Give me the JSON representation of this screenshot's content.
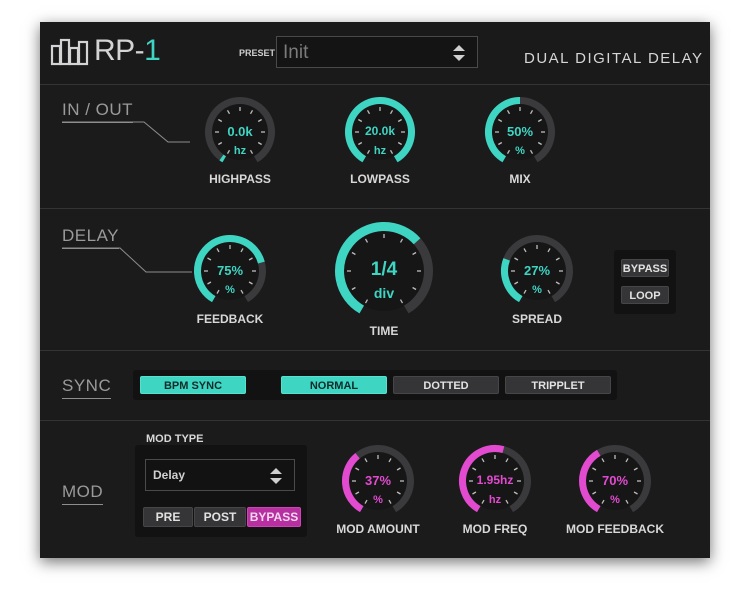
{
  "header": {
    "brand": "RP-",
    "brand_accent": "1",
    "preset_label": "PRESET",
    "preset_value": "Init",
    "title": "DUAL DIGITAL DELAY"
  },
  "sections": {
    "inout": "IN / OUT",
    "delay": "DELAY",
    "sync": "SYNC",
    "mod": "MOD"
  },
  "colors": {
    "accent": "#3fd5c3",
    "mod_accent": "#e24ad0",
    "track": "#3a3a3c",
    "background": "#1b1b1c"
  },
  "knobs": {
    "highpass": {
      "label": "HIGHPASS",
      "value": "0.0k",
      "unit": "hz",
      "level": 0.02
    },
    "lowpass": {
      "label": "LOWPASS",
      "value": "20.0k",
      "unit": "hz",
      "level": 1.0
    },
    "mix": {
      "label": "MIX",
      "value": "50%",
      "unit": "%",
      "level": 0.5
    },
    "feedback": {
      "label": "FEEDBACK",
      "value": "75%",
      "unit": "%",
      "level": 0.75
    },
    "time": {
      "label": "TIME",
      "value": "1/4",
      "unit": "div",
      "level": 0.66
    },
    "spread": {
      "label": "SPREAD",
      "value": "27%",
      "unit": "%",
      "level": 0.27
    },
    "mod_amount": {
      "label": "MOD AMOUNT",
      "value": "37%",
      "unit": "%",
      "level": 0.37
    },
    "mod_freq": {
      "label": "MOD FREQ",
      "value": "1.95hz",
      "unit": "hz",
      "level": 0.55
    },
    "mod_feedback": {
      "label": "MOD FEEDBACK",
      "value": "70%",
      "unit": "%",
      "level": 0.4
    }
  },
  "delay_buttons": {
    "bypass": "BYPASS",
    "loop": "LOOP"
  },
  "sync": {
    "bpm_sync": "BPM SYNC",
    "normal": "NORMAL",
    "dotted": "DOTTED",
    "tripplet": "TRIPPLET"
  },
  "mod": {
    "type_label": "MOD TYPE",
    "type_value": "Delay",
    "pre": "PRE",
    "post": "POST",
    "bypass": "BYPASS"
  }
}
